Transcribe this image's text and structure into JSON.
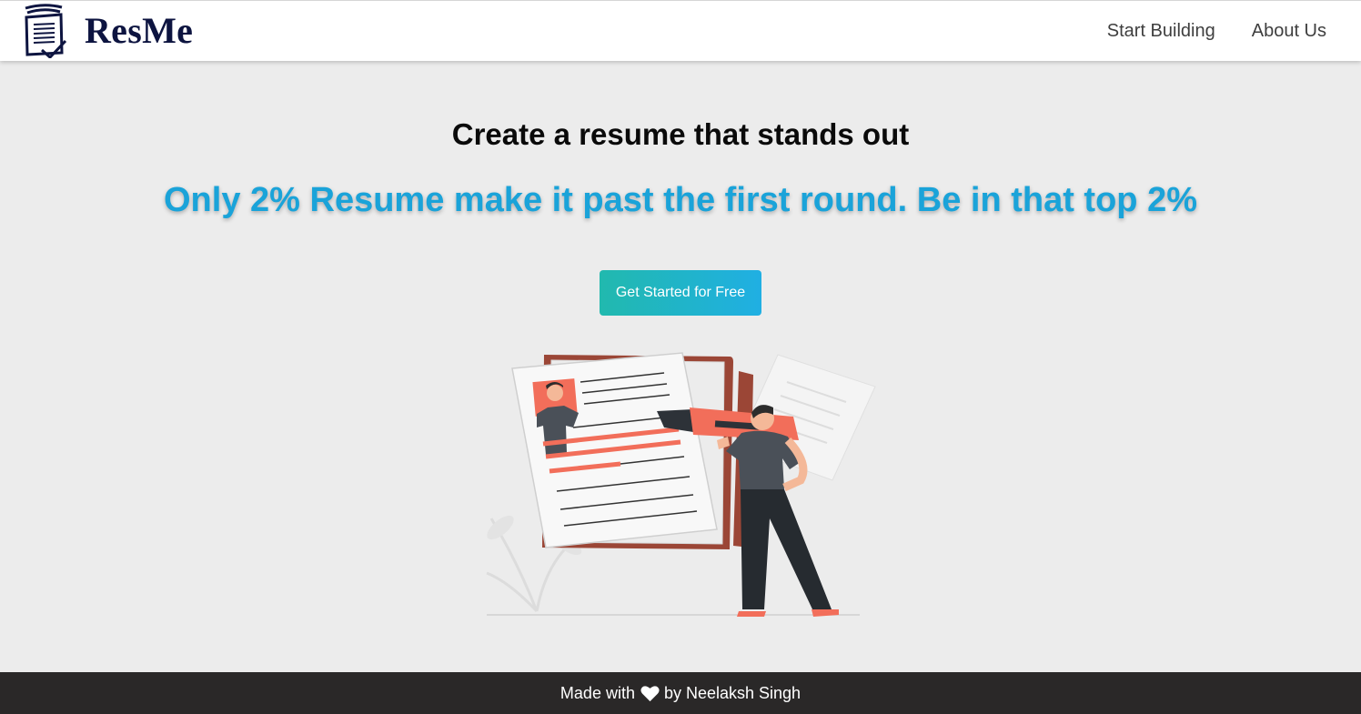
{
  "navbar": {
    "brand_name": "ResMe",
    "logo_icon": "resume-document-icon",
    "links": [
      {
        "label": "Start Building"
      },
      {
        "label": "About Us"
      }
    ]
  },
  "hero": {
    "headline": "Create a resume that stands out",
    "tagline": "Only 2% Resume make it past the first round. Be in that top 2%",
    "cta_label": "Get Started for Free",
    "illustration_icon": "resume-editing-illustration"
  },
  "footer": {
    "text_before": "Made with",
    "heart_icon": "heart-icon",
    "text_after": "by Neelaksh Singh"
  },
  "colors": {
    "brand": "#0d1440",
    "accent": "#1aa3d9",
    "cta_start": "#21b9ae",
    "cta_end": "#20afe3",
    "background": "#ececec",
    "footer": "#2a2828"
  }
}
